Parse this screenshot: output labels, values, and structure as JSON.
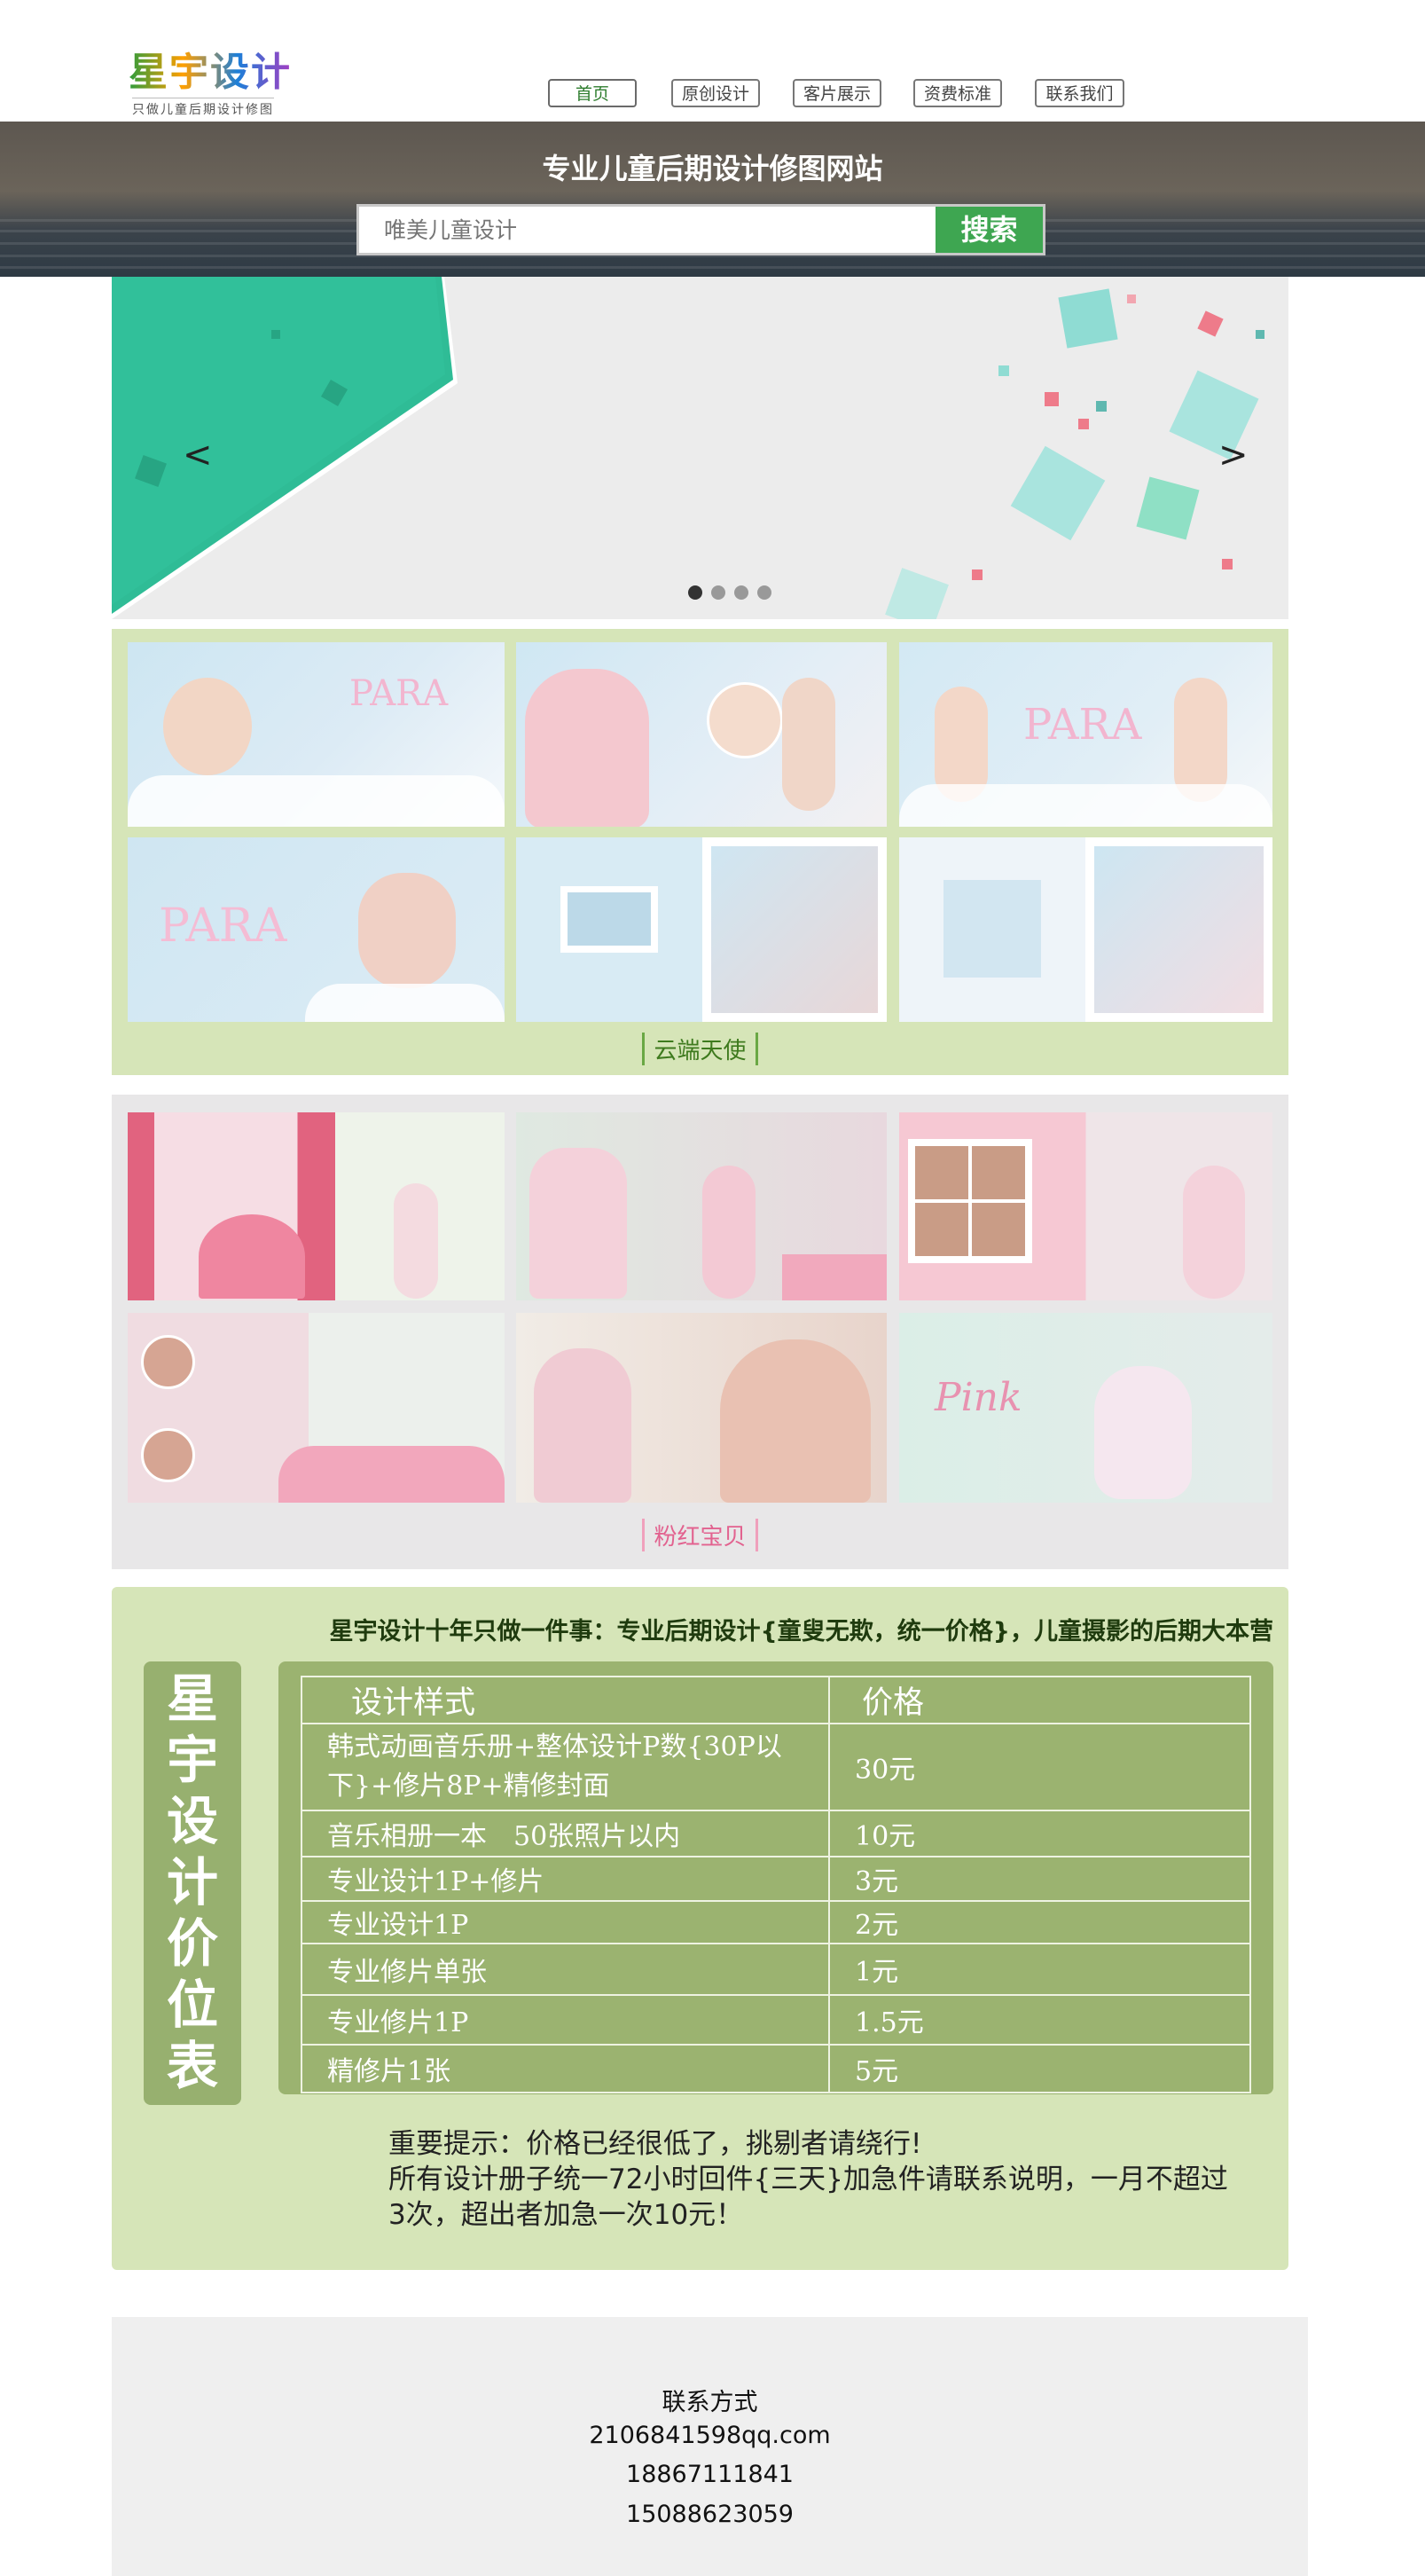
{
  "brand": {
    "logo_text": "星宇设计",
    "logo_subtitle": "只做儿童后期设计修图"
  },
  "nav": {
    "items": [
      {
        "label": "首页",
        "active": true
      },
      {
        "label": "原创设计"
      },
      {
        "label": "客片展示"
      },
      {
        "label": "资费标准"
      },
      {
        "label": "联系我们"
      }
    ]
  },
  "banner": {
    "title": "专业儿童后期设计修图网站",
    "search_placeholder": "唯美儿童设计",
    "search_button": "搜索"
  },
  "slider": {
    "prev_arrow": "<",
    "next_arrow": ">",
    "dots": 4,
    "active_index": 0,
    "colors": {
      "teal": "#2fbc96",
      "aqua": "#8fdcd3",
      "coral": "#ee7b8a"
    }
  },
  "galleries": [
    {
      "name": "云端天使",
      "theme": "blue-white baby album",
      "accent": "#4f8f2a"
    },
    {
      "name": "粉红宝贝",
      "theme": "pink girl album",
      "accent": "#e77aa0"
    }
  ],
  "pricing": {
    "tagline": "星宇设计十年只做一件事：专业后期设计{童叟无欺，统一价格}，儿童摄影的后期大本营",
    "side_title": "星宇设计价位表",
    "header": {
      "style": "设计样式",
      "price": "价格"
    },
    "rows": [
      {
        "style": "韩式动画音乐册+整体设计P数{30P以下}+修片8P+精修封面",
        "price": "30元"
      },
      {
        "style": "音乐相册一本　50张照片以内",
        "price": "10元"
      },
      {
        "style": "专业设计1P+修片",
        "price": "3元"
      },
      {
        "style": "专业设计1P",
        "price": "2元"
      },
      {
        "style": "专业修片单张",
        "price": "1元"
      },
      {
        "style": "专业修片1P",
        "price": "1.5元"
      },
      {
        "style": "精修片1张",
        "price": "5元"
      }
    ],
    "notice_line1": "重要提示：价格已经很低了，挑剔者请绕行!",
    "notice_line2": "所有设计册子统一72小时回件{三天}加急件请联系说明，一月不超过3次，超出者加急一次10元！"
  },
  "footer": {
    "heading": "联系方式",
    "email": "2106841598qq.com",
    "phone1": "18867111841",
    "phone2": "15088623059"
  }
}
